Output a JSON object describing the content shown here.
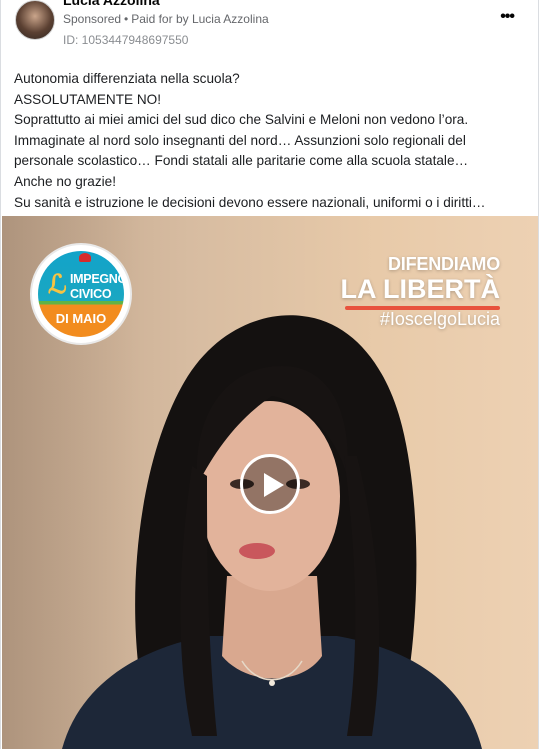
{
  "header": {
    "page_name": "Lucia Azzolina",
    "sponsored": "Sponsored",
    "separator": "•",
    "paid_for_by": "Paid for by Lucia Azzolina",
    "ad_id": "ID: 1053447948697550",
    "more_label": "•••"
  },
  "post": {
    "lines": [
      "Autonomia differenziata nella scuola?",
      "ASSOLUTAMENTE NO!",
      "Soprattutto ai miei amici del sud dico che Salvini e Meloni non vedono l’ora.",
      "Immaginate al nord solo insegnanti del nord… Assunzioni solo regionali del",
      "personale scolastico… Fondi statali alle paritarie come alla scuola statale…",
      "Anche no grazie!",
      "Su sanità e istruzione le decisioni devono essere nazionali, uniformi o i diritti…"
    ]
  },
  "media": {
    "logo": {
      "line1": "IMPEGNO",
      "line2": "CIVICO",
      "line3": "DI MAIO"
    },
    "slogan": {
      "line1": "DIFENDIAMO",
      "line2": "LA LIBERTÀ",
      "hashtag": "#IoscelgoLucia"
    },
    "play_icon": "play-icon"
  },
  "colors": {
    "text": "#1c1e21",
    "meta": "#65676b",
    "logo_blue": "#12a3c9",
    "logo_orange": "#f28c1e",
    "logo_green": "#5fb346",
    "slogan_accent": "#e8523d"
  }
}
